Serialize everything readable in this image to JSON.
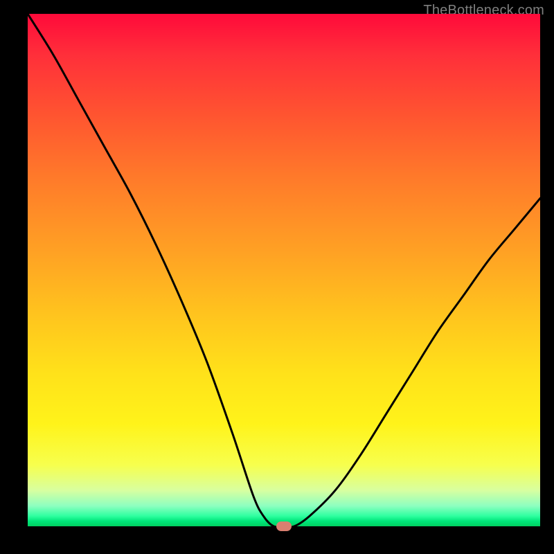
{
  "watermark": {
    "text": "TheBottleneck.com"
  },
  "chart_data": {
    "type": "line",
    "title": "",
    "xlabel": "",
    "ylabel": "",
    "xlim": [
      0,
      100
    ],
    "ylim": [
      0,
      100
    ],
    "series": [
      {
        "name": "curve",
        "x": [
          0,
          5,
          10,
          15,
          20,
          25,
          30,
          35,
          40,
          44,
          46,
          48,
          50,
          52,
          55,
          60,
          65,
          70,
          75,
          80,
          85,
          90,
          95,
          100
        ],
        "values": [
          100,
          92,
          83,
          74,
          65,
          55,
          44,
          32,
          18,
          6,
          2,
          0,
          0,
          0,
          2,
          7,
          14,
          22,
          30,
          38,
          45,
          52,
          58,
          64
        ]
      }
    ],
    "marker": {
      "x": 50,
      "y": 0
    },
    "background_gradient": [
      "#ff0a3a",
      "#ff7a2a",
      "#ffe11a",
      "#00d060"
    ]
  }
}
